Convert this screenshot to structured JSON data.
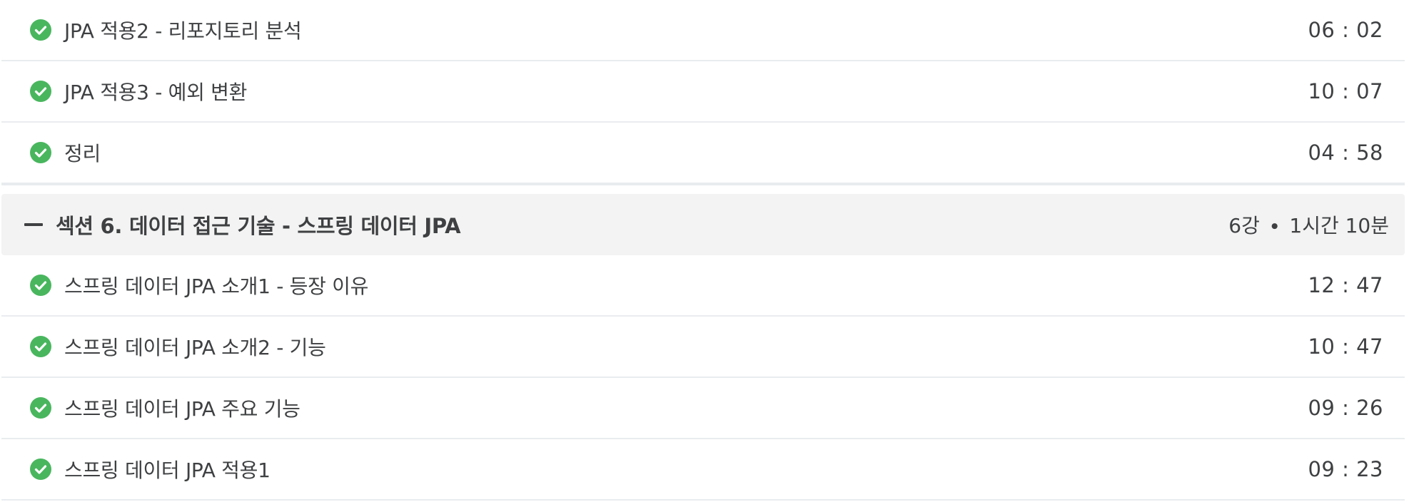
{
  "colors": {
    "check_green": "#49b65e",
    "text": "#3e4042",
    "section_bg": "#f3f3f3",
    "divider": "#e9ecef"
  },
  "lectures_before": [
    {
      "title": "JPA 적용2 - 리포지토리 분석",
      "duration": "06 : 02",
      "status_icon": "check-circle-icon"
    },
    {
      "title": "JPA 적용3 - 예외 변환",
      "duration": "10 : 07",
      "status_icon": "check-circle-icon"
    },
    {
      "title": "정리",
      "duration": "04 : 58",
      "status_icon": "check-circle-icon"
    }
  ],
  "section": {
    "title": "섹션 6. 데이터 접근 기술 - 스프링 데이터 JPA",
    "lecture_count": "6강",
    "separator": "∙",
    "total_time": "1시간 10분",
    "collapse_icon": "minus-icon"
  },
  "lectures_after": [
    {
      "title": "스프링 데이터 JPA 소개1 - 등장 이유",
      "duration": "12 : 47",
      "status_icon": "check-circle-icon"
    },
    {
      "title": "스프링 데이터 JPA 소개2 - 기능",
      "duration": "10 : 47",
      "status_icon": "check-circle-icon"
    },
    {
      "title": "스프링 데이터 JPA 주요 기능",
      "duration": "09 : 26",
      "status_icon": "check-circle-icon"
    },
    {
      "title": "스프링 데이터 JPA 적용1",
      "duration": "09 : 23",
      "status_icon": "check-circle-icon"
    }
  ]
}
